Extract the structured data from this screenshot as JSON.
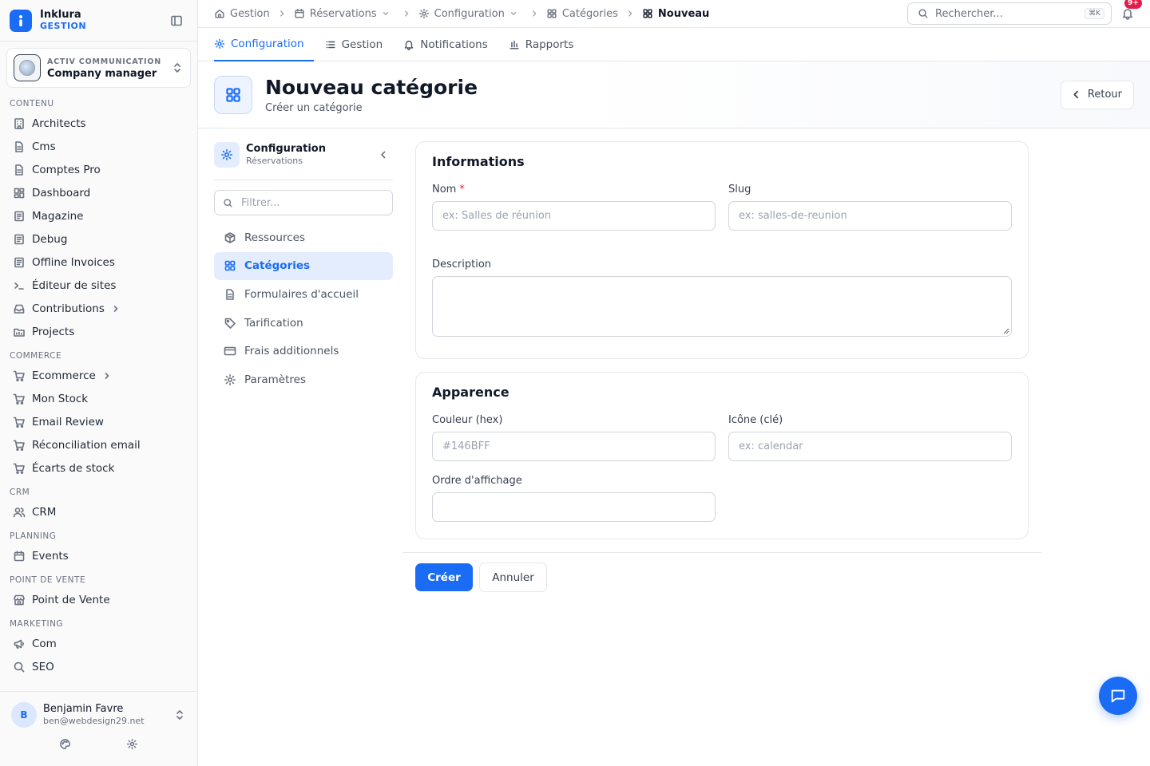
{
  "brand": {
    "name": "Inklura",
    "sub": "GESTION"
  },
  "org": {
    "label": "ACTIV COMMUNICATION",
    "name": "Company manager"
  },
  "nav": {
    "sections": {
      "contenu": "CONTENU",
      "commerce": "COMMERCE",
      "crm": "CRM",
      "planning": "PLANNING",
      "pos": "POINT DE VENTE",
      "marketing": "MARKETING"
    },
    "items": {
      "architects": "Architects",
      "cms": "Cms",
      "comptes_pro": "Comptes Pro",
      "dashboard": "Dashboard",
      "magazine": "Magazine",
      "debug": "Debug",
      "offline_invoices": "Offline Invoices",
      "editeur": "Éditeur de sites",
      "contributions": "Contributions",
      "projects": "Projects",
      "ecommerce": "Ecommerce",
      "mon_stock": "Mon Stock",
      "email_review": "Email Review",
      "reconciliation": "Réconciliation email",
      "ecarts": "Écarts de stock",
      "crm": "CRM",
      "events": "Events",
      "pos": "Point de Vente",
      "com": "Com",
      "seo": "SEO"
    }
  },
  "user": {
    "initial": "B",
    "name": "Benjamin Favre",
    "email": "ben@webdesign29.net"
  },
  "breadcrumb": {
    "gestion": "Gestion",
    "reservations": "Réservations",
    "configuration": "Configuration",
    "categories": "Catégories",
    "current": "Nouveau"
  },
  "search": {
    "placeholder": "Rechercher...",
    "shortcut": "⌘K"
  },
  "notifications": {
    "badge": "9+"
  },
  "tabs": {
    "configuration": "Configuration",
    "gestion": "Gestion",
    "notifications": "Notifications",
    "rapports": "Rapports"
  },
  "header": {
    "title": "Nouveau catégorie",
    "subtitle": "Créer un catégorie",
    "back": "Retour"
  },
  "subnav": {
    "title": "Configuration",
    "subtitle": "Réservations",
    "filter_placeholder": "Filtrer...",
    "items": {
      "ressources": "Ressources",
      "categories": "Catégories",
      "formulaires": "Formulaires d'accueil",
      "tarification": "Tarification",
      "frais": "Frais additionnels",
      "parametres": "Paramètres"
    }
  },
  "form": {
    "informations": {
      "title": "Informations",
      "nom_label": "Nom",
      "required_mark": "*",
      "nom_placeholder": "ex: Salles de réunion",
      "slug_label": "Slug",
      "slug_placeholder": "ex: salles-de-reunion",
      "description_label": "Description"
    },
    "apparence": {
      "title": "Apparence",
      "couleur_label": "Couleur (hex)",
      "couleur_placeholder": "#146BFF",
      "icone_label": "Icône (clé)",
      "icone_placeholder": "ex: calendar",
      "ordre_label": "Ordre d'affichage"
    },
    "submit": "Créer",
    "cancel": "Annuler"
  },
  "colors": {
    "primary": "#1a6cf5",
    "badge": "#e11d48"
  }
}
